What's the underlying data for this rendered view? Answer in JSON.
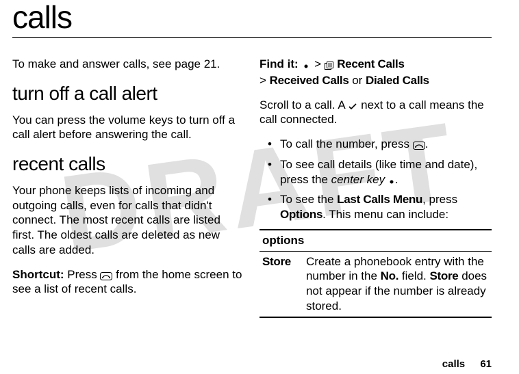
{
  "watermark": "DRAFT",
  "page_title": "calls",
  "left": {
    "intro": "To make and answer calls, see page 21.",
    "h2a": "turn off a call alert",
    "alert_body": "You can press the volume keys to turn off a call alert before answering the call.",
    "h2b": "recent calls",
    "recent_body": "Your phone keeps lists of incoming and outgoing calls, even for calls that didn't connect. The most recent calls are listed first. The oldest calls are deleted as new calls are added.",
    "shortcut_label": "Shortcut:",
    "shortcut_a": " Press ",
    "shortcut_b": " from the home screen to see a list of recent calls."
  },
  "right": {
    "findit_label": "Find it:",
    "gt1": " > ",
    "recent_calls": " Recent Calls",
    "gt2": "> ",
    "received": "Received Calls",
    "or": " or ",
    "dialed": "Dialed Calls",
    "scroll_a": "Scroll to a call. A ",
    "scroll_b": " next to a call means the call connected.",
    "li1a": "To call the number, press ",
    "li1b": ".",
    "li2a": "To see call details (like time and date), press the ",
    "center_key": "center key",
    "li2b": ".",
    "li3a": "To see the ",
    "last_calls_menu": "Last Calls Menu",
    "li3b": ", press ",
    "options_word": "Options",
    "li3c": ". This menu can include:",
    "table": {
      "header": "options",
      "row1": {
        "label": "Store",
        "desc_a": "Create a phonebook entry with the number in the ",
        "no": "No.",
        "desc_b": " field. ",
        "store": "Store",
        "desc_c": " does not appear if the number is already stored."
      }
    }
  },
  "footer": {
    "section": "calls",
    "page": "61"
  }
}
